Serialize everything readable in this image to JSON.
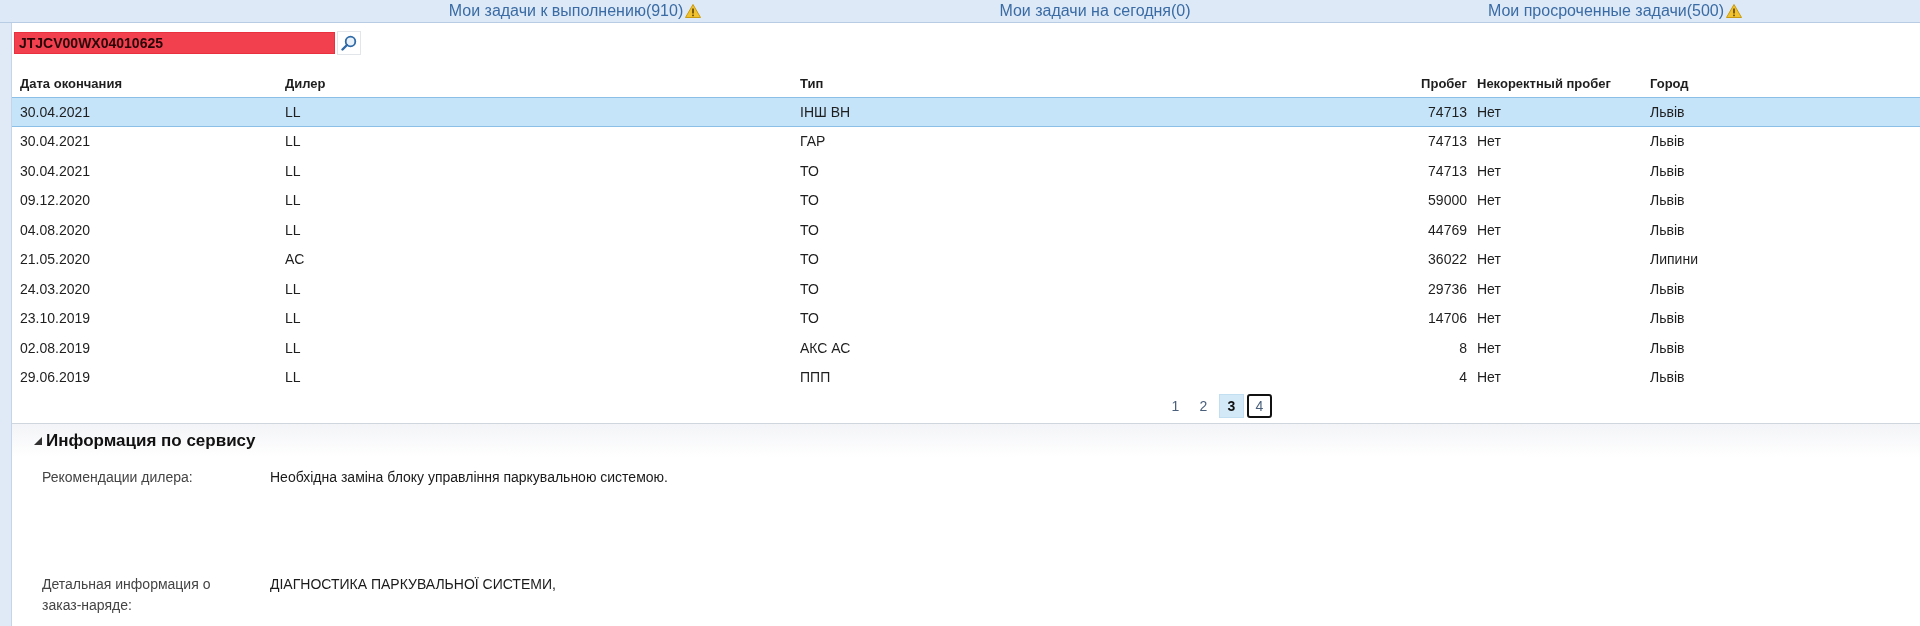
{
  "top_tabs": [
    {
      "label": "Мои задачи к выполнению(910)",
      "warning": true
    },
    {
      "label": "Мои задачи на сегодня(0)",
      "warning": false
    },
    {
      "label": "Мои просроченные задачи(500)",
      "warning": true
    }
  ],
  "search": {
    "value": "JTJCV00WX04010625",
    "highlighted": true
  },
  "table": {
    "columns": [
      {
        "label": "Дата окончания",
        "kind": "text"
      },
      {
        "label": "Дилер",
        "kind": "text"
      },
      {
        "label": "Тип",
        "kind": "text"
      },
      {
        "label": "Пробег",
        "kind": "number"
      },
      {
        "label": "Некоректный пробег",
        "kind": "text"
      },
      {
        "label": "Город",
        "kind": "text"
      }
    ],
    "rows": [
      {
        "cells": [
          "30.04.2021",
          "LL",
          "ІНШ ВН",
          "74713",
          "Нет",
          "Львів"
        ],
        "selected": true
      },
      {
        "cells": [
          "30.04.2021",
          "LL",
          "ГАР",
          "74713",
          "Нет",
          "Львів"
        ],
        "selected": false
      },
      {
        "cells": [
          "30.04.2021",
          "LL",
          "ТО",
          "74713",
          "Нет",
          "Львів"
        ],
        "selected": false
      },
      {
        "cells": [
          "09.12.2020",
          "LL",
          "ТО",
          "59000",
          "Нет",
          "Львів"
        ],
        "selected": false
      },
      {
        "cells": [
          "04.08.2020",
          "LL",
          "ТО",
          "44769",
          "Нет",
          "Львів"
        ],
        "selected": false
      },
      {
        "cells": [
          "21.05.2020",
          "AC",
          "ТО",
          "36022",
          "Нет",
          "Липини"
        ],
        "selected": false
      },
      {
        "cells": [
          "24.03.2020",
          "LL",
          "ТО",
          "29736",
          "Нет",
          "Львів"
        ],
        "selected": false
      },
      {
        "cells": [
          "23.10.2019",
          "LL",
          "ТО",
          "14706",
          "Нет",
          "Львів"
        ],
        "selected": false
      },
      {
        "cells": [
          "02.08.2019",
          "LL",
          "АКС АС",
          "8",
          "Нет",
          "Львів"
        ],
        "selected": false
      },
      {
        "cells": [
          "29.06.2019",
          "LL",
          "ППП",
          "4",
          "Нет",
          "Львів"
        ],
        "selected": false
      }
    ]
  },
  "pagination": {
    "pages": [
      {
        "label": "1",
        "selected": false,
        "focused": false
      },
      {
        "label": "2",
        "selected": false,
        "focused": false
      },
      {
        "label": "3",
        "selected": true,
        "focused": false
      },
      {
        "label": "4",
        "selected": false,
        "focused": true
      }
    ]
  },
  "service_info": {
    "title": "Информация по сервису",
    "expanded": true,
    "fields": [
      {
        "label": "Рекомендации дилера:",
        "value": "Необхідна заміна блоку управління паркувальною системою."
      },
      {
        "label": "Детальная информация о заказ-наряде:",
        "value": "ДІАГНОСТИКА ПАРКУВАЛЬНОЇ СИСТЕМИ,"
      }
    ]
  }
}
